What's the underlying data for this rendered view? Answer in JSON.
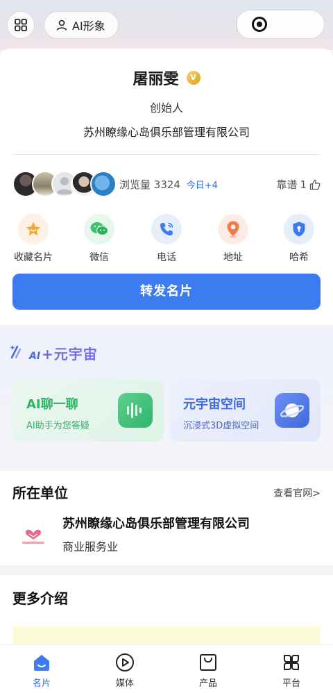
{
  "topbar": {
    "ai_image_label": "AI形象"
  },
  "profile": {
    "name": "屠丽雯",
    "badge": "V",
    "title": "创始人",
    "company": "苏州瞭缘心岛俱乐部管理有限公司"
  },
  "stats": {
    "views_label": "浏览量",
    "views_count": "3324",
    "today_label": "今日+4",
    "likes_label": "靠谱",
    "likes_count": "1"
  },
  "actions": [
    {
      "label": "收藏名片",
      "icon": "star-icon",
      "color": "#f4a93a",
      "bg": "#fdf1e3"
    },
    {
      "label": "微信",
      "icon": "wechat-icon",
      "color": "#3cc26a",
      "bg": "#e6f7ec"
    },
    {
      "label": "电话",
      "icon": "phone-icon",
      "color": "#3d7bf0",
      "bg": "#e6eefc"
    },
    {
      "label": "地址",
      "icon": "location-icon",
      "color": "#f07a4a",
      "bg": "#fdebe4"
    },
    {
      "label": "哈希",
      "icon": "shield-icon",
      "color": "#3d7bf0",
      "bg": "#e6eefc"
    }
  ],
  "forward_button": "转发名片",
  "ai_section": {
    "logo_small": "AI",
    "logo_big": "+元宇宙",
    "chat": {
      "title": "AI聊一聊",
      "subtitle": "AI助手为您答疑",
      "color": "#2fb46a",
      "bg": "#e6f6ed"
    },
    "space": {
      "title": "元宇宙空间",
      "subtitle": "沉浸式3D虚拟空间",
      "color": "#3d6ad8",
      "bg": "#e7ecfb"
    }
  },
  "unit": {
    "heading": "所在单位",
    "link": "查看官网>",
    "company_name": "苏州瞭缘心岛俱乐部管理有限公司",
    "industry": "商业服务业"
  },
  "more": {
    "heading": "更多介绍"
  },
  "tabs": [
    {
      "label": "名片",
      "icon": "home-icon",
      "active": true
    },
    {
      "label": "媒体",
      "icon": "play-icon",
      "active": false
    },
    {
      "label": "产品",
      "icon": "bag-icon",
      "active": false
    },
    {
      "label": "平台",
      "icon": "grid-icon",
      "active": false
    }
  ],
  "colors": {
    "accent": "#3d7bf0",
    "link_blue": "#2f6bef"
  }
}
